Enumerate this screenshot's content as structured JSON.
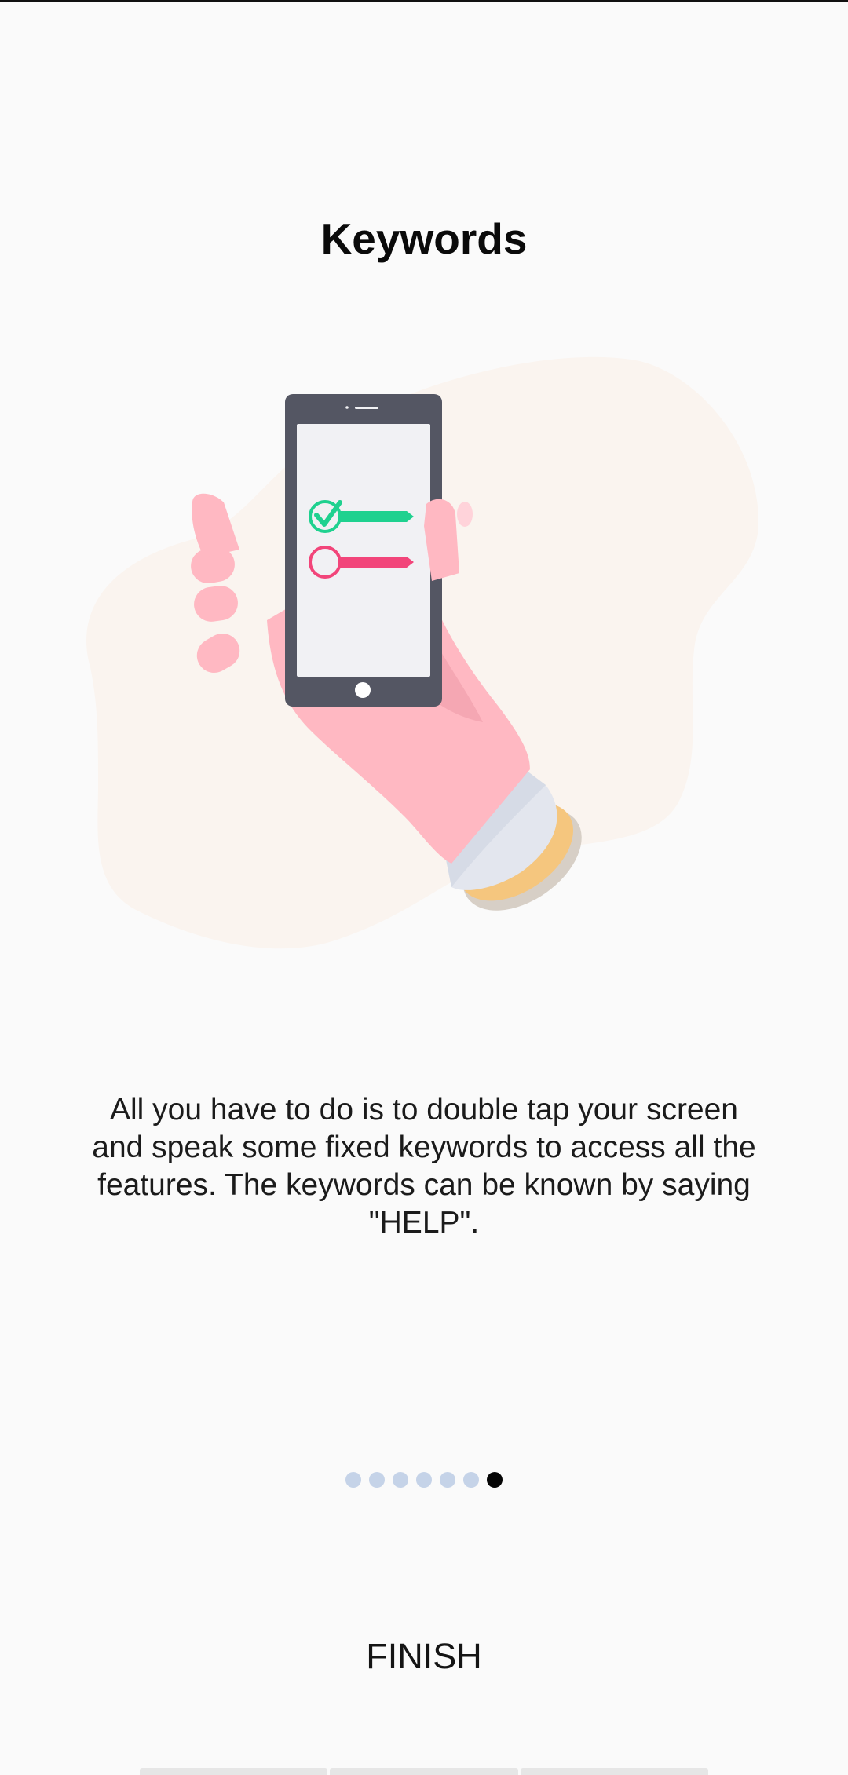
{
  "onboarding": {
    "title": "Keywords",
    "description": "All you have to do is to double tap your screen and speak some fixed keywords to access all the features. The keywords can be known by saying \"HELP\".",
    "illustration_icon": "hand-holding-phone-checklist-icon",
    "page_indicator": {
      "total": 7,
      "current": 7,
      "active_color": "#050505",
      "inactive_color": "#c5d3e8"
    },
    "finish_label": "FINISH"
  }
}
